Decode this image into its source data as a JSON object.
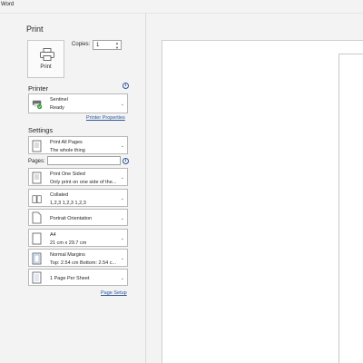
{
  "window": {
    "title": "Word"
  },
  "print": {
    "heading": "Print",
    "print_button_label": "Print",
    "copies_label": "Copies:",
    "copies_value": "1"
  },
  "printer": {
    "section_title": "Printer",
    "name": "Sentinel",
    "status": "Ready",
    "properties_link": "Printer Properties"
  },
  "settings": {
    "section_title": "Settings",
    "print_range": {
      "line1": "Print All Pages",
      "line2": "The whole thing"
    },
    "pages_label": "Pages:",
    "pages_value": "",
    "sides": {
      "line1": "Print One Sided",
      "line2": "Only print on one side of the..."
    },
    "collation": {
      "line1": "Collated",
      "line2": "1,2,3    1,2,3    1,2,3"
    },
    "orientation": {
      "label": "Portrait Orientation"
    },
    "paper": {
      "line1": "A4",
      "line2": "21 cm x 29.7 cm"
    },
    "margins": {
      "line1": "Normal Margins",
      "line2": "Top: 2.54 cm Bottom: 2.54 c..."
    },
    "pages_per_sheet": {
      "label": "1 Page Per Sheet"
    },
    "page_setup_link": "Page Setup"
  },
  "icons": {
    "printer": "printer-icon",
    "info": "info-icon",
    "chevron": "chevron-down-icon"
  },
  "colors": {
    "link": "#2b579a",
    "background": "#f3f3f3"
  }
}
